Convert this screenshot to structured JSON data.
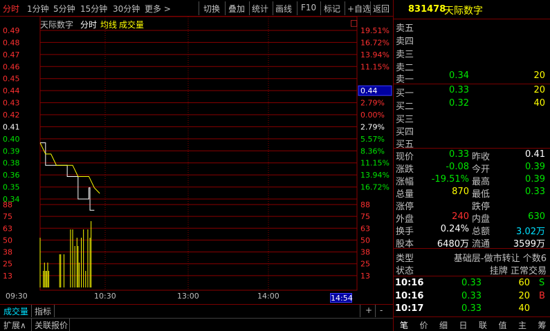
{
  "toolbar": {
    "periods": [
      "分时",
      "1分钟",
      "5分钟",
      "15分钟",
      "30分钟",
      "更多 >"
    ],
    "buttons": [
      "切换",
      "叠加",
      "统计",
      "画线",
      "F10",
      "标记",
      "+自选",
      "返回"
    ]
  },
  "stock": {
    "code": "831478",
    "name": "天际数字"
  },
  "chart_header": {
    "name": "天际数字",
    "mode": "分时",
    "avg_label": "均线",
    "vol_label": "成交量",
    "corner_box": "□"
  },
  "price_axis": {
    "left_labels": [
      "0.49",
      "0.48",
      "0.47",
      "0.46",
      "0.45",
      "0.44",
      "0.43",
      "0.42",
      "0.41",
      "0.40",
      "0.39",
      "0.38",
      "0.36",
      "0.35",
      "0.34"
    ],
    "right_labels": [
      "19.51%",
      "16.72%",
      "13.94%",
      "11.15%",
      "",
      "5.57%",
      "2.79%",
      "0.00%",
      "2.79%",
      "5.57%",
      "8.36%",
      "11.15%",
      "13.94%",
      "16.72%"
    ],
    "current_price_tag": "0.44"
  },
  "volume_axis": {
    "labels": [
      "88",
      "75",
      "63",
      "50",
      "38",
      "25",
      "13"
    ]
  },
  "time_axis": {
    "labels": [
      "09:30",
      "10:30",
      "13:00",
      "14:00"
    ],
    "current_time": "14:54"
  },
  "chart_data": {
    "type": "line",
    "prev_close": 0.41,
    "price": {
      "x": [
        "09:30",
        "09:35",
        "09:40",
        "09:45",
        "09:50",
        "09:55",
        "10:00",
        "10:05",
        "10:10",
        "10:15",
        "10:16",
        "10:17",
        "10:20"
      ],
      "y": [
        0.39,
        0.37,
        0.37,
        0.37,
        0.37,
        0.36,
        0.36,
        0.34,
        0.34,
        0.35,
        0.33,
        0.33,
        0.33
      ]
    },
    "avg": {
      "x": [
        "09:30",
        "09:35",
        "09:40",
        "09:45",
        "09:50",
        "09:55",
        "10:00",
        "10:05",
        "10:10",
        "10:15",
        "10:20",
        "10:25"
      ],
      "y": [
        0.39,
        0.38,
        0.38,
        0.37,
        0.37,
        0.37,
        0.37,
        0.36,
        0.36,
        0.36,
        0.35,
        0.345
      ]
    },
    "volume": {
      "x": [
        "09:30",
        "09:33",
        "09:34",
        "09:35",
        "09:36",
        "09:37",
        "09:38",
        "09:48",
        "09:49",
        "09:52",
        "09:58",
        "10:00",
        "10:02",
        "10:04",
        "10:05",
        "10:06",
        "10:08",
        "10:10",
        "10:12",
        "10:14",
        "10:16",
        "10:17"
      ],
      "y": [
        60,
        20,
        30,
        20,
        20,
        30,
        20,
        40,
        40,
        40,
        70,
        70,
        50,
        60,
        50,
        30,
        60,
        70,
        20,
        70,
        60,
        80
      ]
    },
    "ylim_volume": [
      0,
      100
    ]
  },
  "order_book": {
    "asks": [
      {
        "label": "卖五",
        "price": "",
        "volume": ""
      },
      {
        "label": "卖四",
        "price": "",
        "volume": ""
      },
      {
        "label": "卖三",
        "price": "",
        "volume": ""
      },
      {
        "label": "卖二",
        "price": "",
        "volume": ""
      },
      {
        "label": "卖一",
        "price": "0.34",
        "volume": "20"
      }
    ],
    "bids": [
      {
        "label": "买一",
        "price": "0.33",
        "volume": "20"
      },
      {
        "label": "买二",
        "price": "0.32",
        "volume": "40"
      },
      {
        "label": "买三",
        "price": "",
        "volume": ""
      },
      {
        "label": "买四",
        "price": "",
        "volume": ""
      },
      {
        "label": "买五",
        "price": "",
        "volume": ""
      }
    ]
  },
  "stats": [
    {
      "l1": "现价",
      "v1": "0.33",
      "c1": "dn",
      "l2": "昨收",
      "v2": "0.41",
      "c2": "wht"
    },
    {
      "l1": "涨跌",
      "v1": "-0.08",
      "c1": "dn",
      "l2": "今开",
      "v2": "0.39",
      "c2": "dn"
    },
    {
      "l1": "涨幅",
      "v1": "-19.51%",
      "c1": "dn",
      "l2": "最高",
      "v2": "0.39",
      "c2": "dn"
    },
    {
      "l1": "总量",
      "v1": "870",
      "c1": "yel",
      "l2": "最低",
      "v2": "0.33",
      "c2": "dn"
    },
    {
      "l1": "涨停",
      "v1": "",
      "c1": "up",
      "l2": "跌停",
      "v2": "",
      "c2": "dn"
    },
    {
      "l1": "外盘",
      "v1": "240",
      "c1": "up",
      "l2": "内盘",
      "v2": "630",
      "c2": "dn"
    },
    {
      "l1": "换手",
      "v1": "0.24%",
      "c1": "wht",
      "l2": "总额",
      "v2": "3.02万",
      "c2": "cyan"
    },
    {
      "l1": "股本",
      "v1": "6480万",
      "c1": "wht",
      "l2": "流通",
      "v2": "3599万",
      "c2": "wht"
    }
  ],
  "info": [
    {
      "label": "类型",
      "value": "基础层-做市转让 个数6"
    },
    {
      "label": "状态",
      "value": "挂牌 正常交易"
    }
  ],
  "ticks": [
    {
      "time": "10:16",
      "price": "0.33",
      "volume": "60",
      "flag": "S"
    },
    {
      "time": "10:16",
      "price": "0.33",
      "volume": "20",
      "flag": "B"
    },
    {
      "time": "10:17",
      "price": "0.33",
      "volume": "40",
      "flag": ""
    }
  ],
  "bottom_tabs_1": [
    "成交量",
    "指标"
  ],
  "bottom_tabs_2": [
    "扩展∧",
    "关联报价"
  ],
  "bottom_ctrl": [
    "+",
    "-",
    "□"
  ],
  "right_tabs": [
    "笔",
    "价",
    "细",
    "日",
    "联",
    "值",
    "主",
    "筹"
  ]
}
